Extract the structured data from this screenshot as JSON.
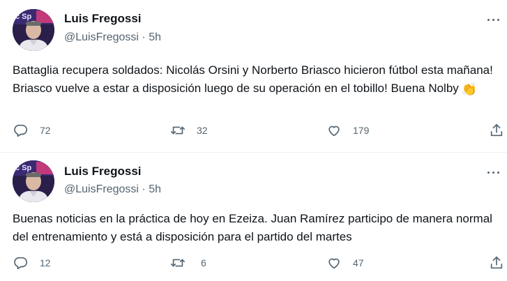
{
  "tweets": [
    {
      "author": "Luis Fregossi",
      "handle": "@LuisFregossi",
      "separator": "·",
      "time": "5h",
      "text": "Battaglia recupera soldados: Nicolás Orsini y Norberto Briasco hicieron fútbol esta mañana! Briasco vuelve a estar a disposición luego de su operación en el tobillo! Buena Nolby",
      "emoji": "👏",
      "replies": "72",
      "retweets": "32",
      "likes": "179"
    },
    {
      "author": "Luis Fregossi",
      "handle": "@LuisFregossi",
      "separator": "·",
      "time": "5h",
      "text": "Buenas noticias en la práctica de hoy en Ezeiza. Juan Ramírez participo de manera normal del entrenamiento y está a disposición para el partido del martes",
      "replies": "12",
      "retweets": "6",
      "likes": "47"
    }
  ],
  "icons": {
    "reply": "reply-icon",
    "retweet": "retweet-icon",
    "like": "like-icon",
    "share": "share-icon",
    "more": "more-icon"
  },
  "colors": {
    "text": "#0f1419",
    "secondary": "#536471",
    "divider": "#eff3f4"
  }
}
